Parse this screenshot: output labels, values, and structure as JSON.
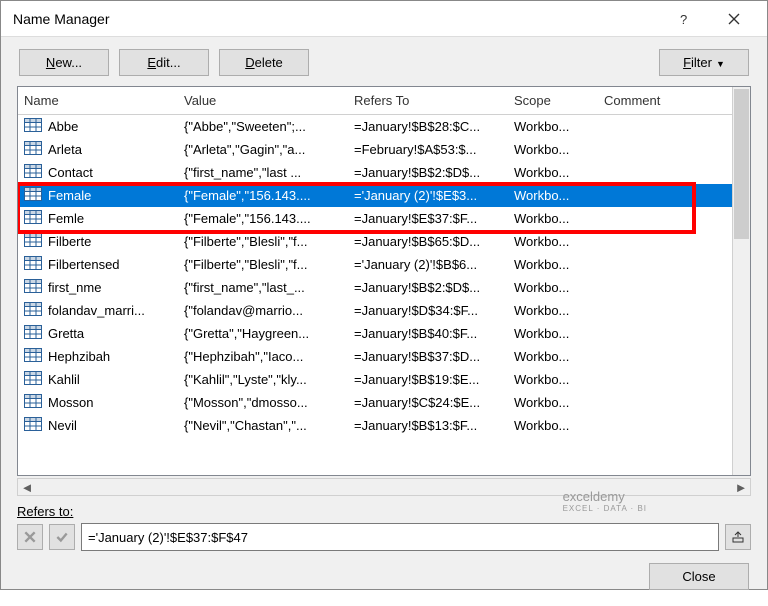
{
  "title": "Name Manager",
  "buttons": {
    "new": "New...",
    "edit": "Edit...",
    "delete": "Delete",
    "filter": "Filter",
    "close": "Close"
  },
  "accel": {
    "new": "N",
    "edit": "E",
    "delete": "D",
    "filter": "F"
  },
  "headers": {
    "name": "Name",
    "value": "Value",
    "refers": "Refers To",
    "scope": "Scope",
    "comment": "Comment"
  },
  "rows": [
    {
      "name": "Abbe",
      "value": "{\"Abbe\",\"Sweeten\";...",
      "refers": "=January!$B$28:$C...",
      "scope": "Workbo...",
      "selected": false
    },
    {
      "name": "Arleta",
      "value": "{\"Arleta\",\"Gagin\",\"a...",
      "refers": "=February!$A$53:$...",
      "scope": "Workbo...",
      "selected": false
    },
    {
      "name": "Contact",
      "value": "{\"first_name\",\"last ...",
      "refers": "=January!$B$2:$D$...",
      "scope": "Workbo...",
      "selected": false
    },
    {
      "name": "Female",
      "value": "{\"Female\",\"156.143....",
      "refers": "='January (2)'!$E$3...",
      "scope": "Workbo...",
      "selected": true
    },
    {
      "name": "Femle",
      "value": "{\"Female\",\"156.143....",
      "refers": "=January!$E$37:$F...",
      "scope": "Workbo...",
      "selected": false
    },
    {
      "name": "Filberte",
      "value": "{\"Filberte\",\"Blesli\",\"f...",
      "refers": "=January!$B$65:$D...",
      "scope": "Workbo...",
      "selected": false
    },
    {
      "name": "Filbertensed",
      "value": "{\"Filberte\",\"Blesli\",\"f...",
      "refers": "='January (2)'!$B$6...",
      "scope": "Workbo...",
      "selected": false
    },
    {
      "name": "first_nme",
      "value": "{\"first_name\",\"last_...",
      "refers": "=January!$B$2:$D$...",
      "scope": "Workbo...",
      "selected": false
    },
    {
      "name": "folandav_marri...",
      "value": "{\"folandav@marrio...",
      "refers": "=January!$D$34:$F...",
      "scope": "Workbo...",
      "selected": false
    },
    {
      "name": "Gretta",
      "value": "{\"Gretta\",\"Haygreen...",
      "refers": "=January!$B$40:$F...",
      "scope": "Workbo...",
      "selected": false
    },
    {
      "name": "Hephzibah",
      "value": "{\"Hephzibah\",\"Iaco...",
      "refers": "=January!$B$37:$D...",
      "scope": "Workbo...",
      "selected": false
    },
    {
      "name": "Kahlil",
      "value": "{\"Kahlil\",\"Lyste\",\"kly...",
      "refers": "=January!$B$19:$E...",
      "scope": "Workbo...",
      "selected": false
    },
    {
      "name": "Mosson",
      "value": "{\"Mosson\",\"dmosso...",
      "refers": "=January!$C$24:$E...",
      "scope": "Workbo...",
      "selected": false
    },
    {
      "name": "Nevil",
      "value": "{\"Nevil\",\"Chastan\",\"...",
      "refers": "=January!$B$13:$F...",
      "scope": "Workbo...",
      "selected": false
    }
  ],
  "refersLabel": "Refers to:",
  "refersValue": "='January (2)'!$E$37:$F$47",
  "watermark": {
    "main": "exceldemy",
    "sub": "EXCEL · DATA · BI"
  }
}
